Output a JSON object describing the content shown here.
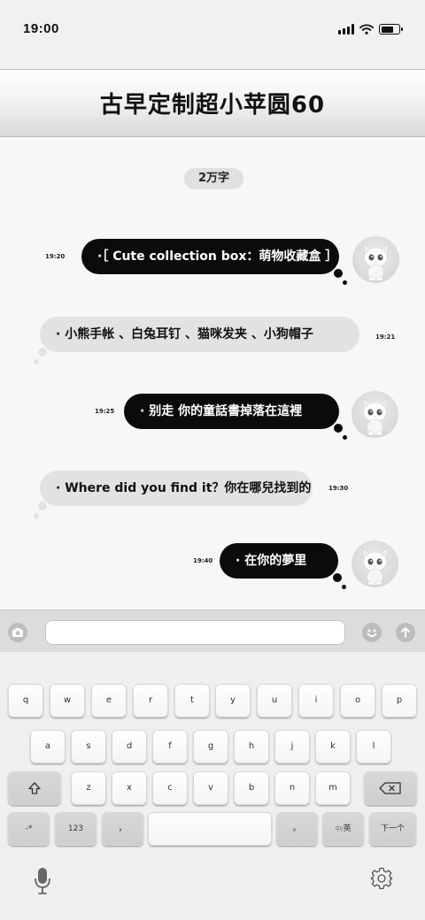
{
  "status_bar": {
    "time": "19:00"
  },
  "header": {
    "title": "古早定制超小苹圆60"
  },
  "chat": {
    "date_chip": "2万字",
    "messages": [
      {
        "direction": "out",
        "text": "·［ Cute collection box：萌物收藏盒 ］",
        "time": "19:20"
      },
      {
        "direction": "in",
        "text": "· 小熊手帐 、白兔耳钉 、猫咪发夹 、小狗帽子",
        "time": "19:21"
      },
      {
        "direction": "out",
        "text": "· 别走 你的童話書掉落在這裡",
        "time": "19:25"
      },
      {
        "direction": "in",
        "text": "· Where did you find it？你在哪兒找到的",
        "time": "19:30"
      },
      {
        "direction": "out",
        "text": "· 在你的夢里",
        "time": "19:40"
      }
    ]
  },
  "input_bar": {
    "text_field_value": ""
  },
  "keyboard": {
    "row1": [
      "q",
      "w",
      "e",
      "r",
      "t",
      "y",
      "u",
      "i",
      "o",
      "p"
    ],
    "row2": [
      "a",
      "s",
      "d",
      "f",
      "g",
      "h",
      "j",
      "k",
      "l"
    ],
    "row3": [
      "z",
      "x",
      "c",
      "v",
      "b",
      "n",
      "m"
    ],
    "row4": {
      "symbols": "-*",
      "numbers": "123",
      "comma": "，",
      "space": "",
      "period": "。",
      "lang_prefix": "中/",
      "lang_main": "英",
      "next": "下一个"
    }
  },
  "icons": [
    "camera-icon",
    "emoji-icon",
    "arrow-up-icon",
    "shift-icon",
    "backspace-icon",
    "microphone-icon",
    "gear-icon",
    "cat-avatar-icon"
  ]
}
